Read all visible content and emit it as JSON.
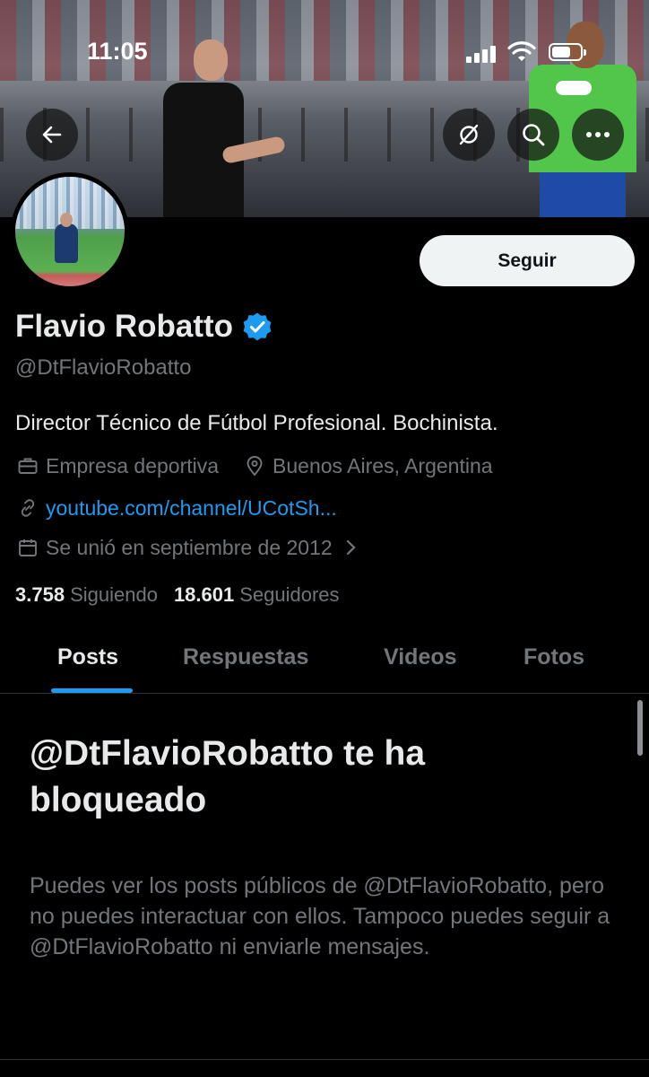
{
  "status_bar": {
    "time": "11:05"
  },
  "header": {
    "back_icon": "arrow-left-icon",
    "actions": [
      "sync-off-icon",
      "search-icon",
      "more-icon"
    ]
  },
  "profile": {
    "follow_label": "Seguir",
    "name": "Flavio Robatto",
    "verified": true,
    "handle": "@DtFlavioRobatto",
    "bio": "Director Técnico de Fútbol Profesional. Bochinista.",
    "category": "Empresa deportiva",
    "location": "Buenos Aires, Argentina",
    "website": "youtube.com/channel/UCotSh...",
    "joined": "Se unió en septiembre de 2012",
    "following_count": "3.758",
    "following_label": "Siguiendo",
    "followers_count": "18.601",
    "followers_label": "Seguidores"
  },
  "tabs": [
    {
      "label": "Posts",
      "active": true
    },
    {
      "label": "Respuestas",
      "active": false
    },
    {
      "label": "Videos",
      "active": false
    },
    {
      "label": "Fotos",
      "active": false
    }
  ],
  "blocked": {
    "title": "@DtFlavioRobatto te ha bloqueado",
    "description": "Puedes ver los posts públicos de @DtFlavioRobatto, pero no puedes interactuar con ellos. Tampoco puedes seguir a @DtFlavioRobatto ni enviarle mensajes."
  },
  "colors": {
    "accent": "#1d9bf0",
    "background": "#000000",
    "muted": "#71767b",
    "text": "#e7e9ea"
  }
}
